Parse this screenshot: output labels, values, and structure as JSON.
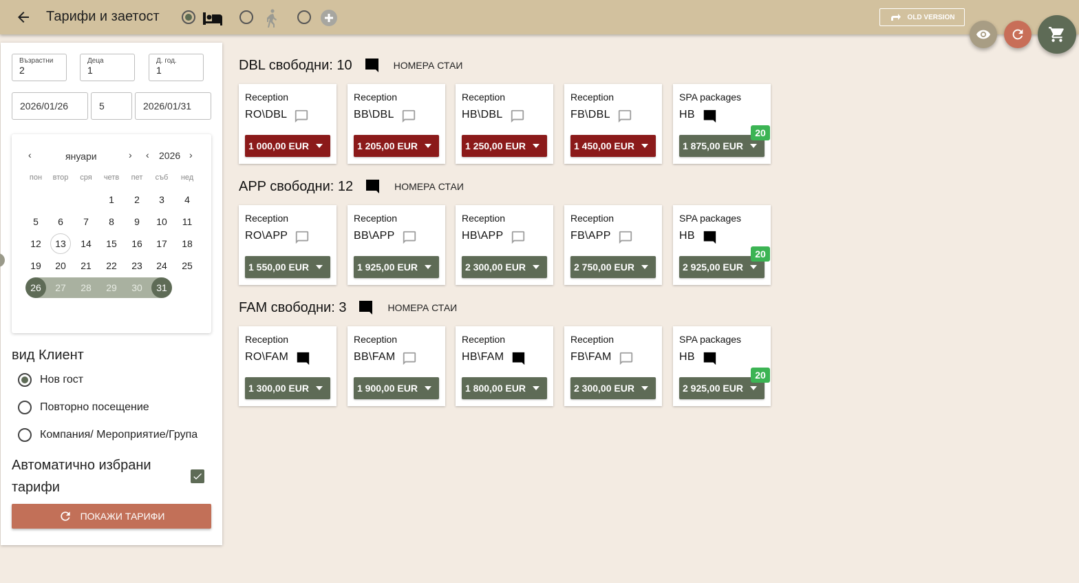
{
  "header": {
    "title": "Тарифи и заетост",
    "old_version_label": "OLD VERSION",
    "modes": [
      {
        "icon": "bed-icon",
        "checked": true
      },
      {
        "icon": "walking-person-icon",
        "checked": false
      },
      {
        "icon": "add-circle-icon",
        "checked": false
      }
    ]
  },
  "guests": {
    "adults_label": "Възрастни",
    "adults_value": "2",
    "children_label": "Деца",
    "children_value": "1",
    "extra_label": "Д. год.",
    "extra_value": "1"
  },
  "dates": {
    "from": "2026/01/26",
    "nights": "5",
    "to": "2026/01/31"
  },
  "calendar": {
    "month": "януари",
    "year": "2026",
    "weekdays": [
      "пон",
      "втор",
      "сря",
      "четв",
      "пет",
      "съб",
      "нед"
    ],
    "weeks": [
      [
        "",
        "",
        "",
        "1",
        "2",
        "3",
        "4"
      ],
      [
        "5",
        "6",
        "7",
        "8",
        "9",
        "10",
        "11"
      ],
      [
        "12",
        "13",
        "14",
        "15",
        "16",
        "17",
        "18"
      ],
      [
        "19",
        "20",
        "21",
        "22",
        "23",
        "24",
        "25"
      ],
      [
        "26",
        "27",
        "28",
        "29",
        "30",
        "31",
        ""
      ]
    ],
    "today": "13",
    "range_start": "26",
    "range_end": "31"
  },
  "client_type": {
    "title": "вид Клиент",
    "options": [
      {
        "label": "Нов гост",
        "checked": true
      },
      {
        "label": "Повторно посещение",
        "checked": false
      },
      {
        "label": "Компания/ Мероприятие/Група",
        "checked": false
      }
    ]
  },
  "auto_rates": {
    "label": "Автоматично избрани тарифи",
    "checked": true
  },
  "show_rates_label": "ПОКАЖИ ТАРИФИ",
  "room_numbers_label": "НОМЕРА СТАИ",
  "colors": {
    "red_price": "#8b1a1a",
    "green_price": "#5e6b56",
    "badge": "#3cb454",
    "topbar": "#d2c19e",
    "background": "#f3ebe2",
    "accent": "#c27058"
  },
  "rooms": [
    {
      "title": "DBL свободни: 10",
      "chat_filled": true,
      "rates": [
        {
          "source": "Reception",
          "code": "RO\\DBL",
          "chat_filled": false,
          "price": "1 000,00 EUR",
          "color": "red",
          "badge": ""
        },
        {
          "source": "Reception",
          "code": "BB\\DBL",
          "chat_filled": false,
          "price": "1 205,00 EUR",
          "color": "red",
          "badge": ""
        },
        {
          "source": "Reception",
          "code": "HB\\DBL",
          "chat_filled": false,
          "price": "1 250,00 EUR",
          "color": "red",
          "badge": ""
        },
        {
          "source": "Reception",
          "code": "FB\\DBL",
          "chat_filled": false,
          "price": "1 450,00 EUR",
          "color": "red",
          "badge": ""
        },
        {
          "source": "SPA packages",
          "code": "HB",
          "chat_filled": true,
          "price": "1 875,00 EUR",
          "color": "green",
          "badge": "20"
        }
      ]
    },
    {
      "title": "APP свободни: 12",
      "chat_filled": true,
      "rates": [
        {
          "source": "Reception",
          "code": "RO\\APP",
          "chat_filled": false,
          "price": "1 550,00 EUR",
          "color": "green",
          "badge": ""
        },
        {
          "source": "Reception",
          "code": "BB\\APP",
          "chat_filled": false,
          "price": "1 925,00 EUR",
          "color": "green",
          "badge": ""
        },
        {
          "source": "Reception",
          "code": "HB\\APP",
          "chat_filled": false,
          "price": "2 300,00 EUR",
          "color": "green",
          "badge": ""
        },
        {
          "source": "Reception",
          "code": "FB\\APP",
          "chat_filled": false,
          "price": "2 750,00 EUR",
          "color": "green",
          "badge": ""
        },
        {
          "source": "SPA packages",
          "code": "HB",
          "chat_filled": true,
          "price": "2 925,00 EUR",
          "color": "green",
          "badge": "20"
        }
      ]
    },
    {
      "title": "FAM свободни: 3",
      "chat_filled": true,
      "rates": [
        {
          "source": "Reception",
          "code": "RO\\FAM",
          "chat_filled": true,
          "price": "1 300,00 EUR",
          "color": "green",
          "badge": ""
        },
        {
          "source": "Reception",
          "code": "BB\\FAM",
          "chat_filled": false,
          "price": "1 900,00 EUR",
          "color": "green",
          "badge": ""
        },
        {
          "source": "Reception",
          "code": "HB\\FAM",
          "chat_filled": true,
          "price": "1 800,00 EUR",
          "color": "green",
          "badge": ""
        },
        {
          "source": "Reception",
          "code": "FB\\FAM",
          "chat_filled": false,
          "price": "2 300,00 EUR",
          "color": "green",
          "badge": ""
        },
        {
          "source": "SPA packages",
          "code": "HB",
          "chat_filled": true,
          "price": "2 925,00 EUR",
          "color": "green",
          "badge": "20"
        }
      ]
    }
  ]
}
